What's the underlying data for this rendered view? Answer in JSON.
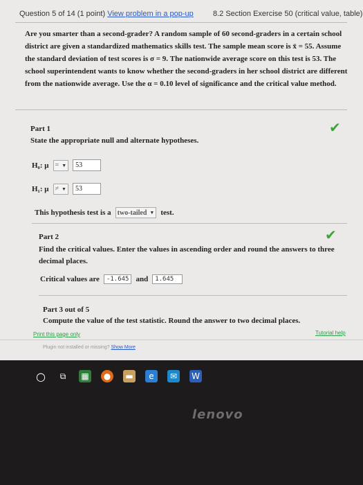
{
  "header": {
    "question_text": "Question 5 of 14 (1 point)",
    "popup_link": "View problem in a pop-up",
    "section": "8.2 Section Exercise 50 (critical value, table)"
  },
  "problem_text": "Are you smarter than a second-grader? A random sample of 60 second-graders in a certain school district are given a standardized mathematics skills test. The sample mean score is x̄ = 55. Assume the standard deviation of test scores is σ = 9. The nationwide average score on this test is 53. The school superintendent wants to know whether the second-graders in her school district are different from the nationwide average. Use the α = 0.10 level of significance and the critical value method.",
  "part1": {
    "title": "Part 1",
    "instruction": "State the appropriate null and alternate hypotheses.",
    "h0_label": "H₀: μ",
    "h0_symbol": "=",
    "h0_value": "53",
    "h1_label": "H₁: μ",
    "h1_symbol": "≠",
    "h1_value": "53",
    "test_prefix": "This hypothesis test is a",
    "test_type": "two-tailed",
    "test_suffix": "test."
  },
  "part2": {
    "title": "Part 2",
    "instruction": "Find the critical values. Enter the values in ascending order and round the answers to three decimal places.",
    "prefix": "Critical values are",
    "value1": "-1.645",
    "and": "and",
    "value2": "1.645"
  },
  "part3": {
    "title": "Part 3 out of 5",
    "instruction": "Compute the value of the test statistic. Round the answer to two decimal places."
  },
  "footer": {
    "print": "Print this page only",
    "tutorial": "Tutorial help",
    "plugin": "Plugin not installed or missing?",
    "show_more": "Show More"
  },
  "brand": "lenovo",
  "colors": {
    "check": "#3aa53a",
    "link": "#2b59c3",
    "taskbar": "#1d1b1c"
  }
}
